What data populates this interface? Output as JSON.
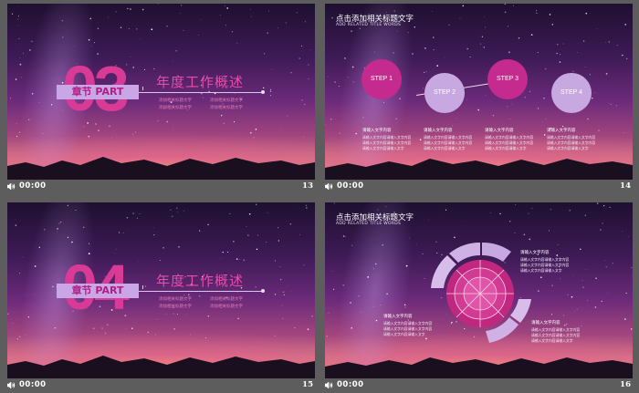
{
  "footer": {
    "time": "00:00"
  },
  "slides": [
    {
      "number": "13",
      "chapter_number": "03",
      "chapter_label": "章节 PART",
      "title": "年度工作概述",
      "subs": [
        "添加相关标题文字",
        "添加相关标题文字",
        "添加相关标题文字",
        "添加相关标题文字"
      ]
    },
    {
      "number": "14",
      "title": "点击添加相关标题文字",
      "subtitle": "ADD RELATED TITLE WORDS",
      "steps": [
        "STEP 1",
        "STEP 2",
        "STEP 3",
        "STEP 4"
      ],
      "blocks": [
        {
          "title": "请输入文字内容",
          "lines": [
            "请输入文字内容请输入文字内容",
            "请输入文字内容请输入文字内容",
            "请输入文字内容请输入文字"
          ]
        },
        {
          "title": "请输入文字内容",
          "lines": [
            "请输入文字内容请输入文字内容",
            "请输入文字内容请输入文字内容",
            "请输入文字内容请输入文字"
          ]
        },
        {
          "title": "请输入文字内容",
          "lines": [
            "请输入文字内容请输入文字内容",
            "请输入文字内容请输入文字内容",
            "请输入文字内容请输入文字"
          ]
        },
        {
          "title": "请输入文字内容",
          "lines": [
            "请输入文字内容请输入文字内容",
            "请输入文字内容请输入文字内容",
            "请输入文字内容请输入文字"
          ]
        }
      ]
    },
    {
      "number": "15",
      "chapter_number": "04",
      "chapter_label": "章节 PART",
      "title": "年度工作概述",
      "subs": [
        "添加相关标题文字",
        "添加相关标题文字",
        "添加相关标题文字",
        "添加相关标题文字"
      ]
    },
    {
      "number": "16",
      "title": "点击添加相关标题文字",
      "subtitle": "ADD RELATED TITLE WORDS",
      "blocks": [
        {
          "title": "请输入文字内容",
          "lines": [
            "请输入文字内容请输入文字内容",
            "请输入文字内容请输入文字内容",
            "请输入文字内容请输入文字"
          ]
        },
        {
          "title": "请输入文字内容",
          "lines": [
            "请输入文字内容请输入文字内容",
            "请输入文字内容请输入文字内容",
            "请输入文字内容请输入文字"
          ]
        }
      ]
    }
  ],
  "colors": {
    "accent_pink": "#d83a95",
    "accent_lilac": "#c8a8e0",
    "background": "#5d5d5d"
  },
  "icons": {
    "footer": "speaker-icon"
  }
}
